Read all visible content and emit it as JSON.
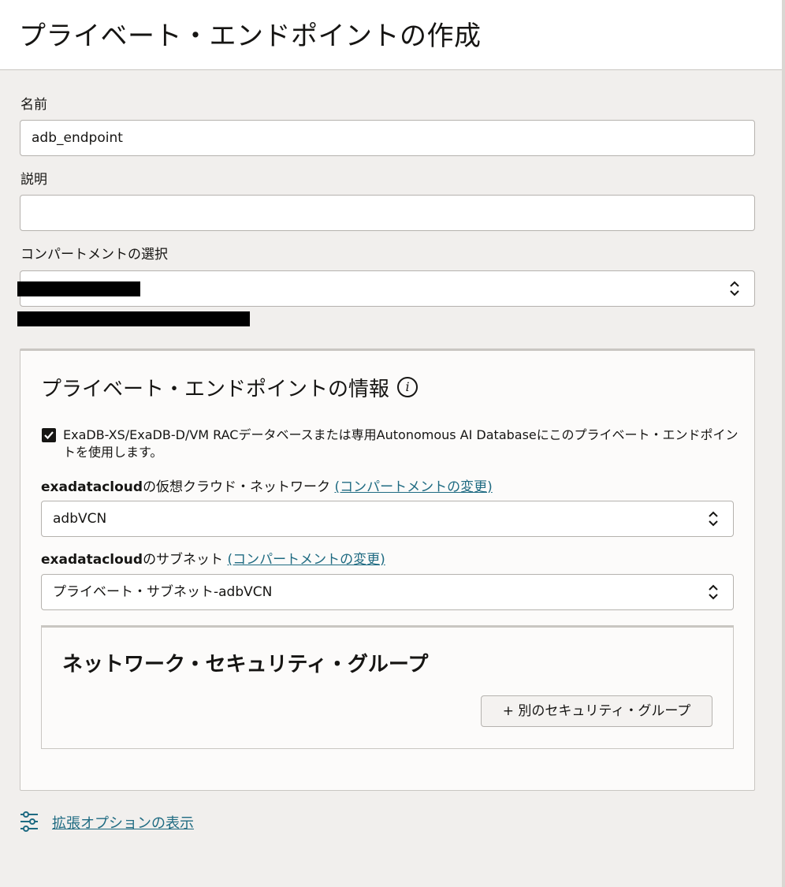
{
  "page": {
    "title": "プライベート・エンドポイントの作成"
  },
  "form": {
    "name_label": "名前",
    "name_value": "adb_endpoint",
    "description_label": "説明",
    "description_value": "",
    "compartment_label": "コンパートメントの選択"
  },
  "panel": {
    "title": "プライベート・エンドポイントの情報",
    "info_icon_glyph": "i",
    "checkbox_checked": true,
    "checkbox_label": "ExaDB-XS/ExaDB-D/VM RACデータベースまたは専用Autonomous AI Databaseにこのプライベート・エンドポイントを使用します。",
    "vcn_label_bold": "exadatacloud",
    "vcn_label_rest": "の仮想クラウド・ネットワーク ",
    "change_compartment_link": "(コンパートメントの変更)",
    "vcn_value": "adbVCN",
    "subnet_label_bold": "exadatacloud",
    "subnet_label_rest": "のサブネット ",
    "subnet_value": "プライベート・サブネット-adbVCN",
    "nsg": {
      "title": "ネットワーク・セキュリティ・グループ",
      "add_button": "+ 別のセキュリティ・グループ"
    }
  },
  "advanced": {
    "link": "拡張オプションの表示",
    "icon": "sliders-icon"
  },
  "colors": {
    "background": "#f1efed",
    "link": "#1f6b82",
    "text": "#161513"
  }
}
